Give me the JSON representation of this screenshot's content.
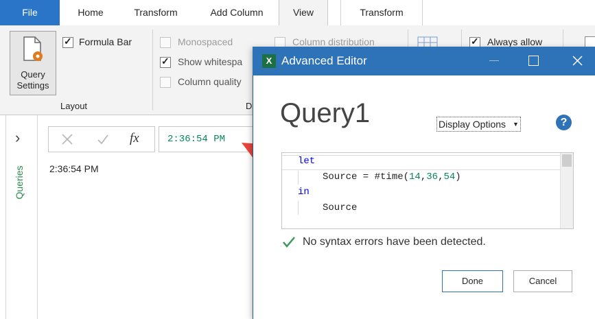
{
  "ribbon": {
    "tabs": [
      {
        "label": "File"
      },
      {
        "label": "Home"
      },
      {
        "label": "Transform"
      },
      {
        "label": "Add Column"
      },
      {
        "label": "View"
      },
      {
        "label": "Transform"
      }
    ],
    "query_settings_label_line1": "Query",
    "query_settings_label_line2": "Settings",
    "formula_bar_label": "Formula Bar",
    "layout_group": "Layout",
    "monospaced_label": "Monospaced",
    "show_whitespace_label": "Show whitespa",
    "column_quality_label": "Column quality",
    "data_preview_group_initial": "D",
    "column_distribution_label": "Column distribution",
    "always_allow_label": "Always allow"
  },
  "formula_bar": {
    "fx": "fx",
    "value": "2:36:54 PM"
  },
  "queries_pane": {
    "label": "Queries",
    "expand_glyph": "›"
  },
  "preview": {
    "cell": "2:36:54 PM"
  },
  "dialog": {
    "title": "Advanced Editor",
    "app_badge": "X",
    "query_name": "Query1",
    "display_options": "Display Options",
    "help_glyph": "?",
    "code": {
      "line1": "let",
      "line2_a": "Source = #time(",
      "line2_n1": "14",
      "line2_n2": "36",
      "line2_n3": "54",
      "line3": "in",
      "line4": "Source"
    },
    "status": "No syntax errors have been detected.",
    "done": "Done",
    "cancel": "Cancel"
  },
  "colors": {
    "accent": "#2e72b8",
    "keyword": "#0000ff",
    "number": "#098658",
    "ok_green": "#3a9a5b",
    "arrow": "#e8453c"
  }
}
